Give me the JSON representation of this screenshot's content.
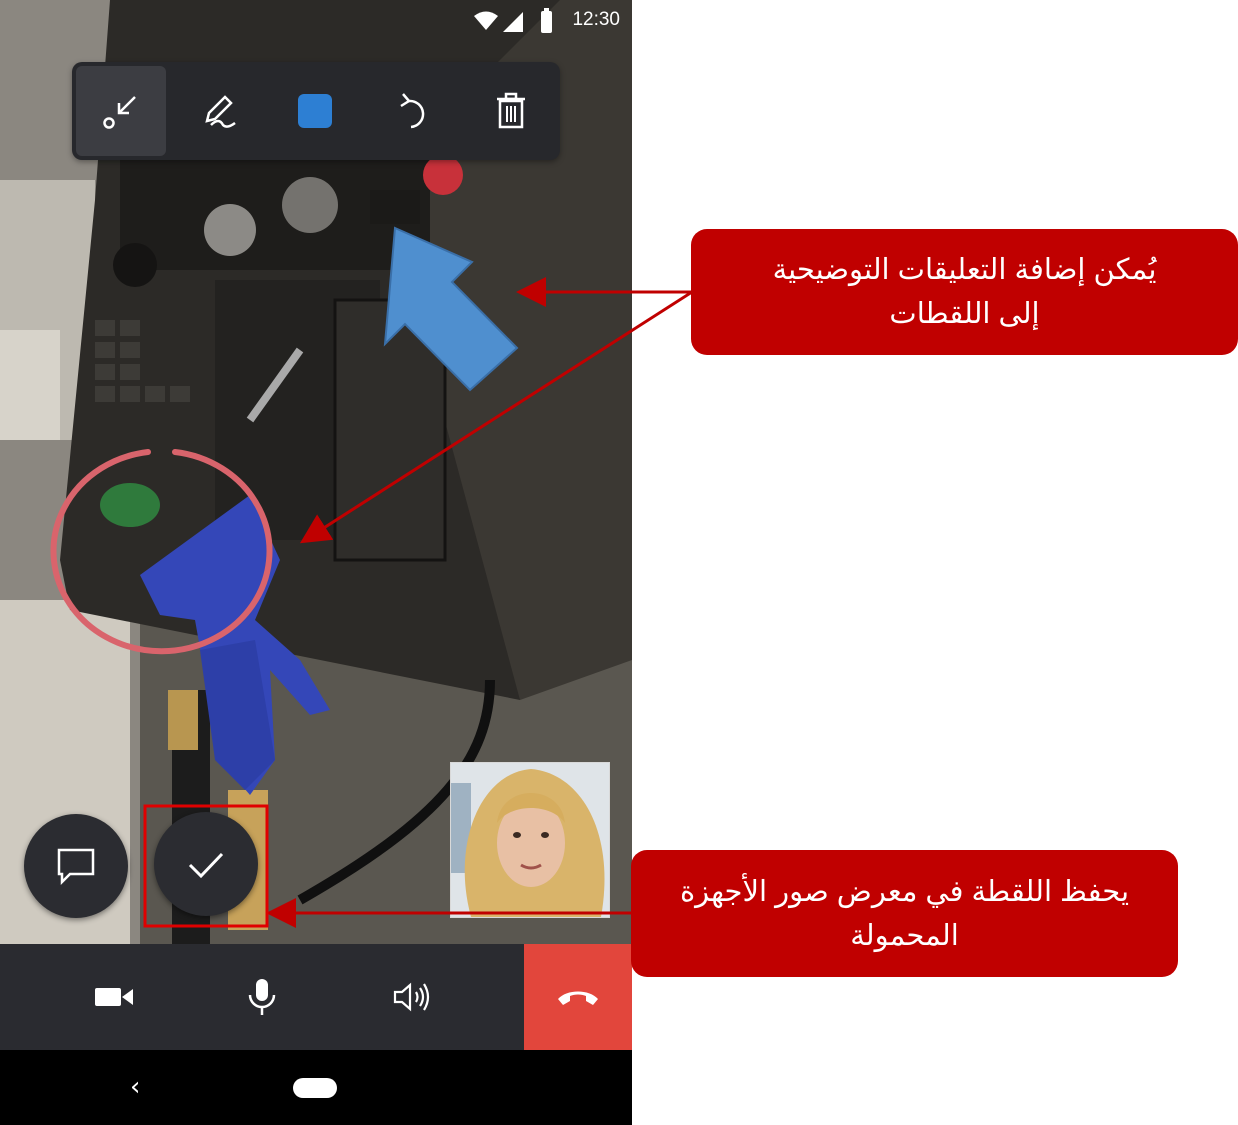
{
  "status_bar": {
    "time": "12:30"
  },
  "toolbar": {
    "items": [
      {
        "name": "pointer-tool",
        "icon": "arrow-pointer-icon",
        "active": true
      },
      {
        "name": "pen-tool",
        "icon": "pen-icon",
        "active": false
      },
      {
        "name": "color-picker",
        "icon": "color-swatch-icon",
        "color": "#2d7fd3",
        "active": false
      },
      {
        "name": "undo",
        "icon": "undo-icon",
        "active": false
      },
      {
        "name": "delete",
        "icon": "trash-icon",
        "active": false
      }
    ]
  },
  "annotations": {
    "arrow_color": "#4f8fcf",
    "circle_color": "#d9646c"
  },
  "actions": {
    "chat_icon": "chat-bubble-icon",
    "save_icon": "checkmark-icon"
  },
  "call_controls": {
    "items": [
      "video-icon",
      "microphone-icon",
      "speaker-icon"
    ],
    "end_call_icon": "end-call-icon",
    "end_call_color": "#e2463c"
  },
  "nav": {
    "back": "‹"
  },
  "callouts": {
    "top": {
      "line1": "يُمكن إضافة التعليقات التوضيحية",
      "line2": "إلى اللقطات"
    },
    "bottom": {
      "line1": "يحفظ اللقطة في معرض صور الأجهزة",
      "line2": "المحمولة"
    },
    "color": "#c00000"
  }
}
